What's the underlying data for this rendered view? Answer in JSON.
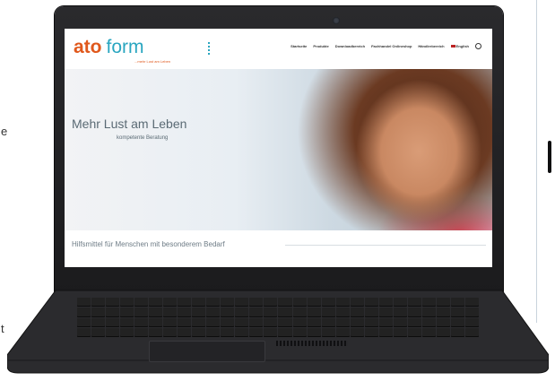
{
  "page_edge": {
    "left_letter_1": "e",
    "left_letter_2": "t"
  },
  "site": {
    "logo": {
      "word1": "ato",
      "word2": "form",
      "tagline": "...mehr Lust am Leben"
    },
    "nav": [
      "Startseite",
      "Produkte",
      "Downloadbereich",
      "Fachhandel Onlineshop",
      "Händlerbereich"
    ],
    "language": "English",
    "hero": {
      "title": "Mehr Lust am Leben",
      "subtitle": "kompetente Beratung"
    },
    "footer": "Hilfsmittel für Menschen mit besonderem Bedarf"
  },
  "colors": {
    "brand_orange": "#e0581c",
    "brand_teal": "#2aa6c0",
    "text_gray": "#5a6a74"
  }
}
